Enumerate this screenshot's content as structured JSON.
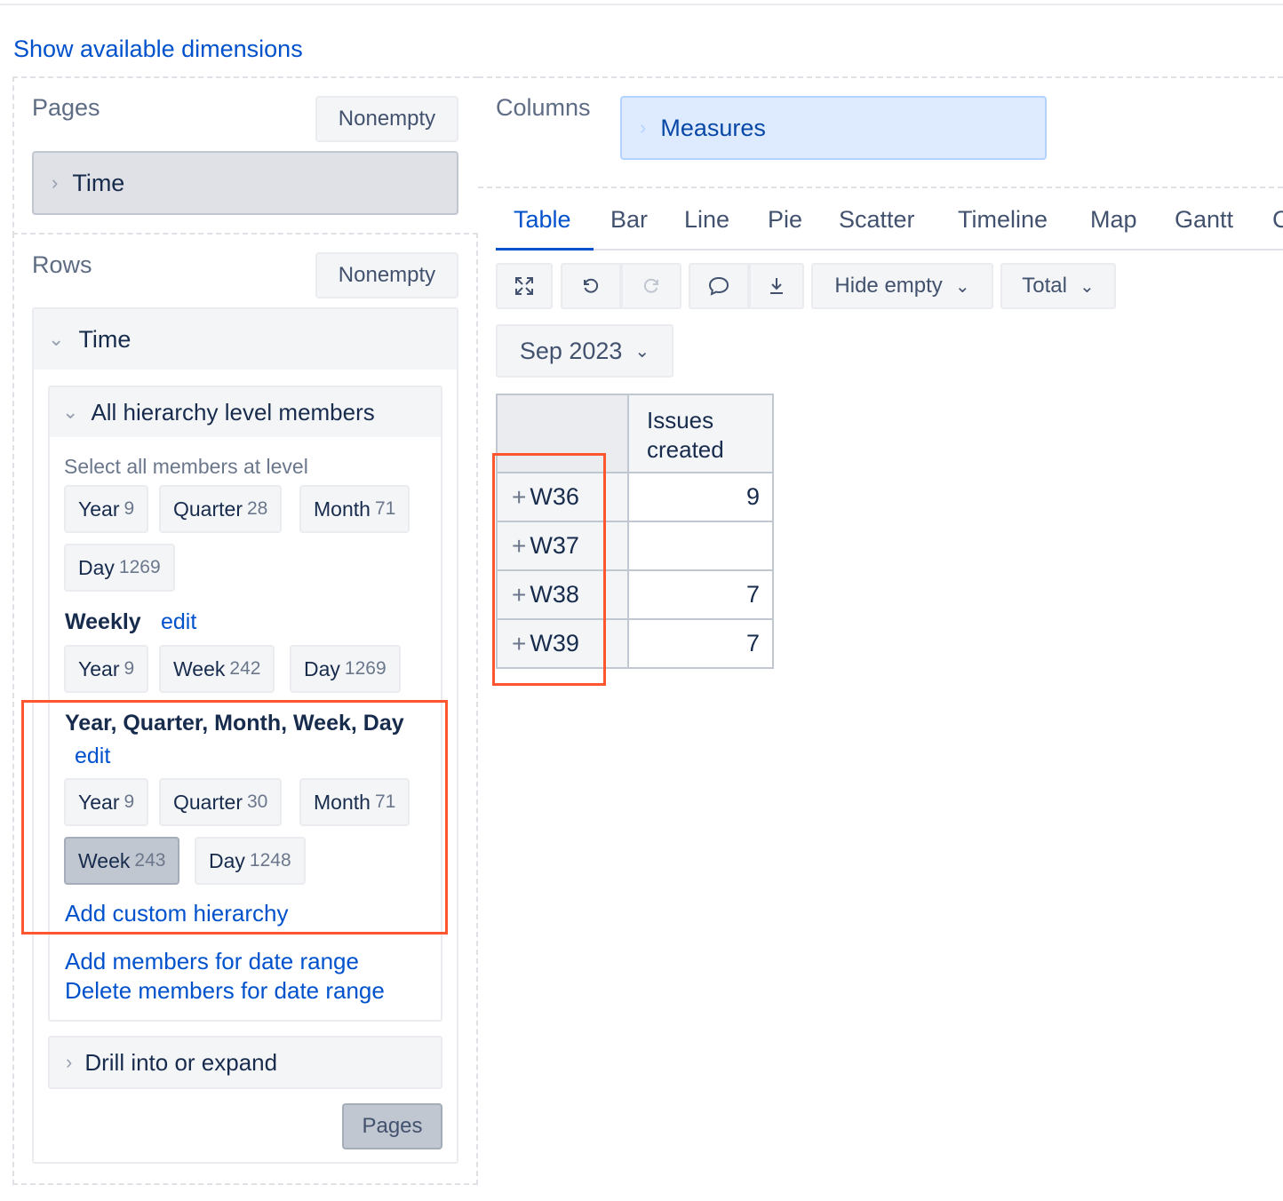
{
  "header": {
    "show_dimensions": "Show available dimensions"
  },
  "pages": {
    "label": "Pages",
    "nonempty": "Nonempty",
    "dimension": "Time"
  },
  "rows": {
    "label": "Rows",
    "nonempty": "Nonempty",
    "dimension": "Time",
    "hierarchy_panel": {
      "title": "All hierarchy level members",
      "select_all_label": "Select all members at level",
      "default_levels": [
        {
          "name": "Year",
          "count": "9"
        },
        {
          "name": "Quarter",
          "count": "28"
        },
        {
          "name": "Month",
          "count": "71"
        },
        {
          "name": "Day",
          "count": "1269"
        }
      ],
      "weekly": {
        "title": "Weekly",
        "edit": "edit",
        "levels": [
          {
            "name": "Year",
            "count": "9"
          },
          {
            "name": "Week",
            "count": "242"
          },
          {
            "name": "Day",
            "count": "1269"
          }
        ]
      },
      "custom": {
        "title": "Year, Quarter, Month, Week, Day",
        "edit": "edit",
        "levels": [
          {
            "name": "Year",
            "count": "9"
          },
          {
            "name": "Quarter",
            "count": "30"
          },
          {
            "name": "Month",
            "count": "71"
          },
          {
            "name": "Week",
            "count": "243"
          },
          {
            "name": "Day",
            "count": "1248"
          }
        ]
      },
      "add_custom": "Add custom hierarchy",
      "add_range": "Add members for date range",
      "delete_range": "Delete members for date range"
    },
    "drill": "Drill into or expand",
    "pages_button": "Pages"
  },
  "columns": {
    "label": "Columns",
    "dimension": "Measures"
  },
  "tabs": [
    "Table",
    "Bar",
    "Line",
    "Pie",
    "Scatter",
    "Timeline",
    "Map",
    "Gantt",
    "C"
  ],
  "toolbar": {
    "hide_empty": "Hide empty",
    "total": "Total"
  },
  "page_filter": "Sep 2023",
  "table": {
    "header": [
      "Issues",
      "created"
    ],
    "rows": [
      {
        "label": "W36",
        "value": "9"
      },
      {
        "label": "W37",
        "value": ""
      },
      {
        "label": "W38",
        "value": "7"
      },
      {
        "label": "W39",
        "value": "7"
      }
    ]
  },
  "colors": {
    "link": "#0052cc",
    "highlight": "#ff5630",
    "measures_bg": "#deebff"
  }
}
